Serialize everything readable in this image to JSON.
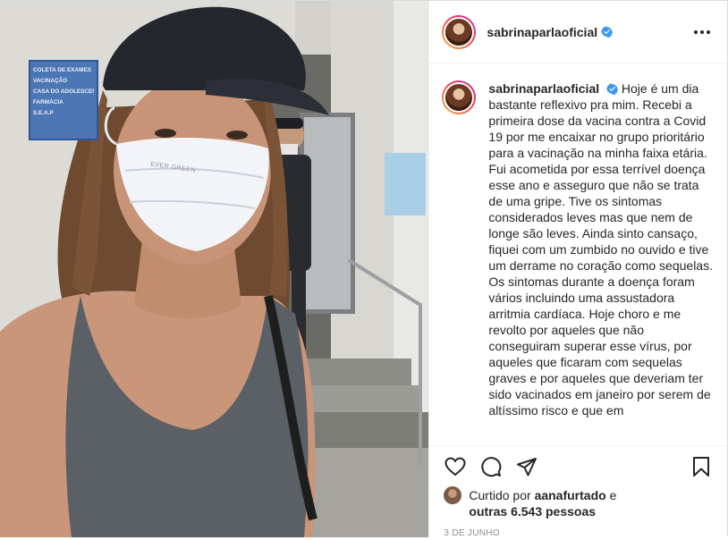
{
  "post": {
    "username": "sabrinaparlaoficial",
    "verified": true,
    "caption_text": "Hoje é um dia bastante reflexivo pra mim. Recebi a primeira dose da vacina contra a Covid 19 por me encaixar no grupo prioritário para a vacinação na minha faixa etária. Fui acometida por essa terrível doença esse ano e asseguro que não se trata de uma gripe. Tive os sintomas considerados leves mas que nem de longe são leves. Ainda sinto cansaço, fiquei com um zumbido no ouvido e tive um derrame no coração como sequelas. Os sintomas durante a doença foram vários incluindo uma assustadora arritmia cardíaca. Hoje choro e me revolto por aqueles que não conseguiram superar esse vírus, por aqueles que ficaram com sequelas graves e por aqueles que deveriam ter sido vacinados em janeiro por serem de altíssimo risco e que em",
    "liked_by_prefix": "Curtido por",
    "liked_by_user": "aanafurtado",
    "liked_by_and": "e",
    "others_count": "outras 6.543 pessoas",
    "date": "3 DE JUNHO"
  },
  "photo": {
    "sign_lines": [
      "COLETA DE EXAMES",
      "VACINAÇÃO",
      "CASA DO ADOLESCENTE",
      "FARMÁCIA",
      "S.E.A.P"
    ],
    "mask_text": "EVER GREEN"
  },
  "icons": {
    "verified": "verified-badge-icon",
    "more": "more-options-icon",
    "like": "heart-icon",
    "comment": "comment-icon",
    "share": "paper-plane-icon",
    "save": "bookmark-icon"
  },
  "colors": {
    "verified": "#3897f0",
    "text": "#262626",
    "muted": "#8e8e8e",
    "border": "#dbdbdb"
  }
}
